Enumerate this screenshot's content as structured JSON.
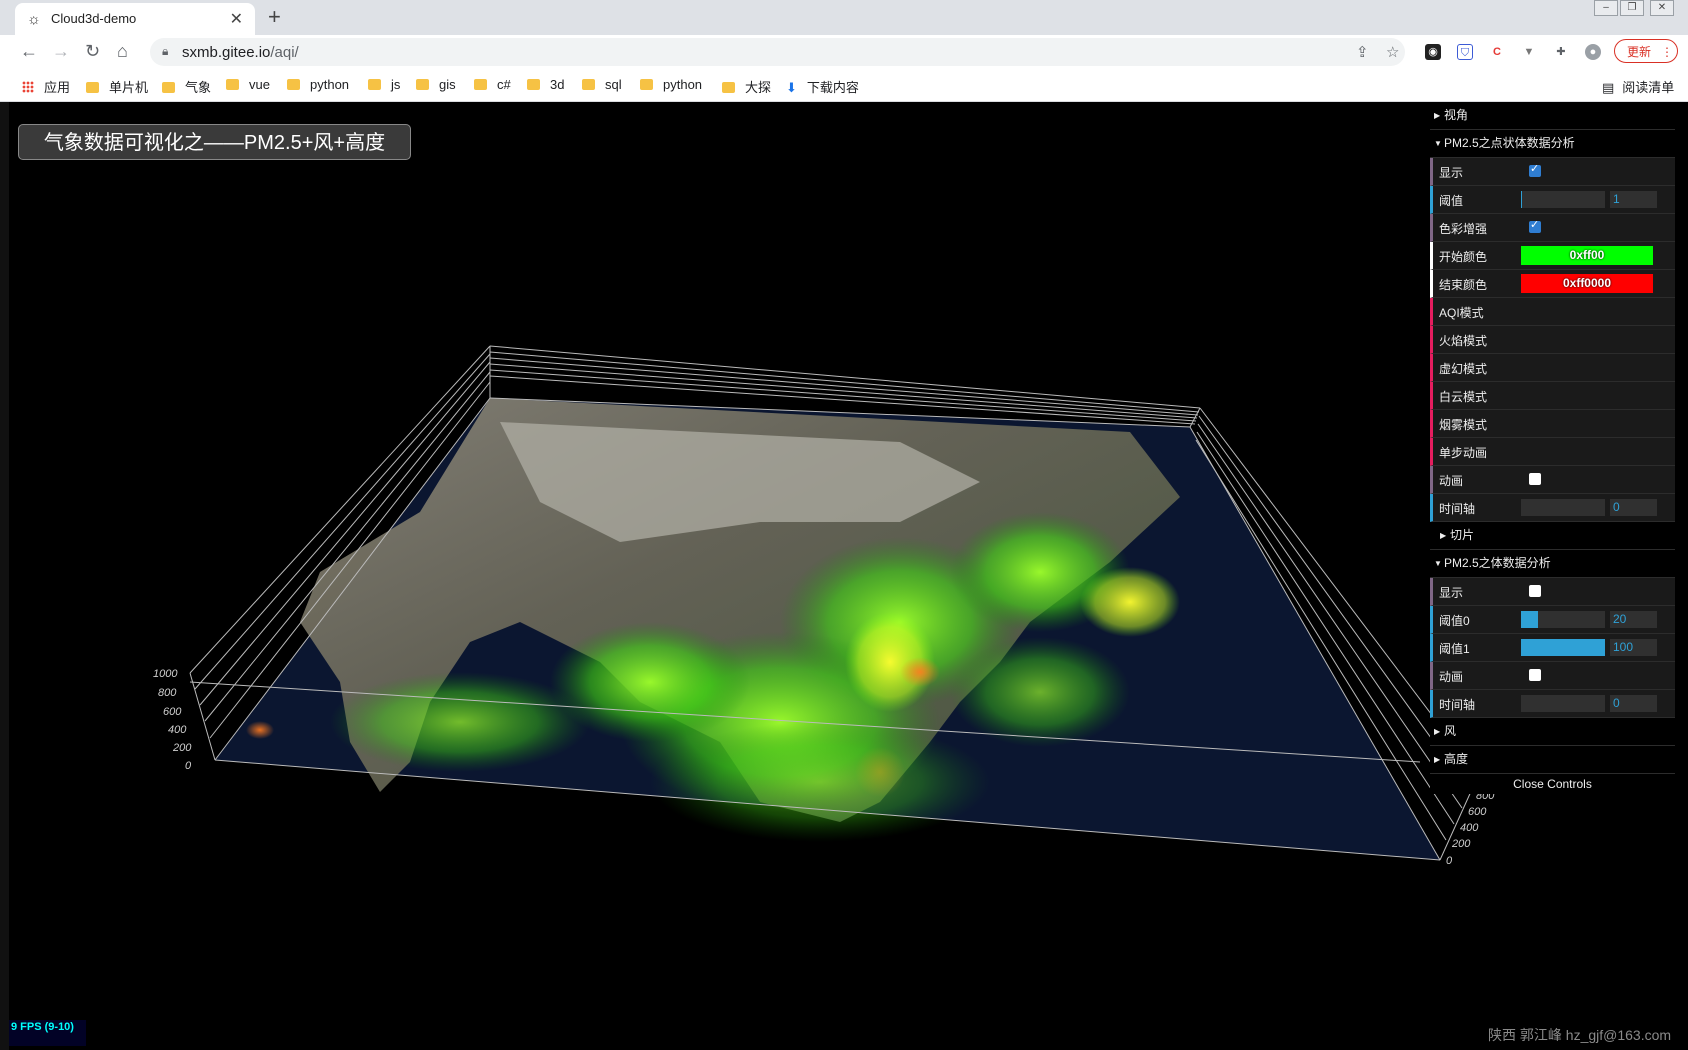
{
  "browser": {
    "tab_title": "Cloud3d-demo",
    "url_host": "sxmb.gitee.io",
    "url_path": "/aqi/",
    "update_label": "更新",
    "bookmarks": [
      "应用",
      "单片机",
      "气象",
      "vue",
      "python",
      "js",
      "gis",
      "c#",
      "3d",
      "sql",
      "python",
      "大探",
      "下载内容"
    ],
    "reading_list": "阅读清单",
    "ext_icons": [
      "extension-1-icon",
      "extension-2-icon",
      "csdn-icon",
      "vpn-icon",
      "puzzle-icon",
      "profile-icon"
    ]
  },
  "page": {
    "title": "气象数据可视化之——PM2.5+风+高度",
    "fps": "9 FPS (9-10)",
    "watermark": "陕西 郭江峰 hz_gjf@163.com"
  },
  "axis_ticks": [
    "1000",
    "800",
    "600",
    "400",
    "200",
    "0"
  ],
  "gui": {
    "folders": {
      "view": "视角",
      "points": "PM2.5之点状体数据分析",
      "slice": "切片",
      "volume": "PM2.5之体数据分析",
      "wind": "风",
      "height": "高度"
    },
    "points": {
      "show_label": "显示",
      "threshold_label": "阈值",
      "threshold_value": "1",
      "threshold_fill": 0.01,
      "enhance_label": "色彩增强",
      "start_color_label": "开始颜色",
      "start_color": "0xff00",
      "start_color_hex": "#00ff00",
      "end_color_label": "结束颜色",
      "end_color": "0xff0000",
      "end_color_hex": "#ff0000",
      "aqi_mode": "AQI模式",
      "flame_mode": "火焰模式",
      "fantasy_mode": "虚幻模式",
      "cloud_mode": "白云模式",
      "smoke_mode": "烟雾模式",
      "step_anim": "单步动画",
      "anim_label": "动画",
      "timeline_label": "时间轴",
      "timeline_value": "0"
    },
    "volume": {
      "show_label": "显示",
      "threshold0_label": "阈值0",
      "threshold0_value": "20",
      "threshold0_fill": 0.2,
      "threshold1_label": "阈值1",
      "threshold1_value": "100",
      "threshold1_fill": 1.0,
      "anim_label": "动画",
      "timeline_label": "时间轴",
      "timeline_value": "0"
    },
    "close_label": "Close Controls"
  }
}
